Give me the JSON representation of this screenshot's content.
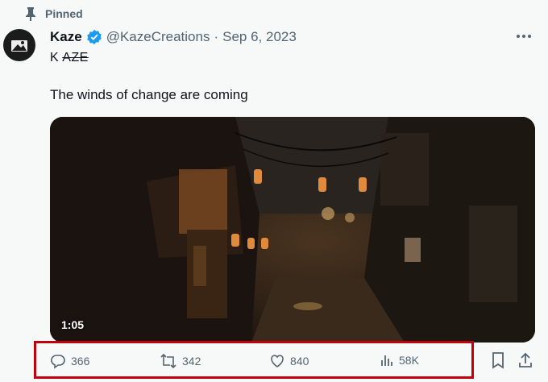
{
  "pinned_label": "Pinned",
  "author": {
    "name": "Kaze",
    "handle": "@KazeCreations",
    "separator": "·",
    "date": "Sep 6, 2023"
  },
  "subtitle": {
    "plain": "K",
    "struck": "AZE"
  },
  "tweet_text": "The winds of change are coming",
  "video": {
    "duration": "1:05"
  },
  "actions": {
    "replies": "366",
    "reposts": "342",
    "likes": "840",
    "views": "58K"
  },
  "icons": [
    "pin-icon",
    "verified-icon",
    "more-icon",
    "reply-icon",
    "repost-icon",
    "like-icon",
    "views-icon",
    "bookmark-icon",
    "share-icon"
  ],
  "colors": {
    "accent": "#1d9bf0",
    "highlight": "#c0000c",
    "muted": "#536471"
  }
}
